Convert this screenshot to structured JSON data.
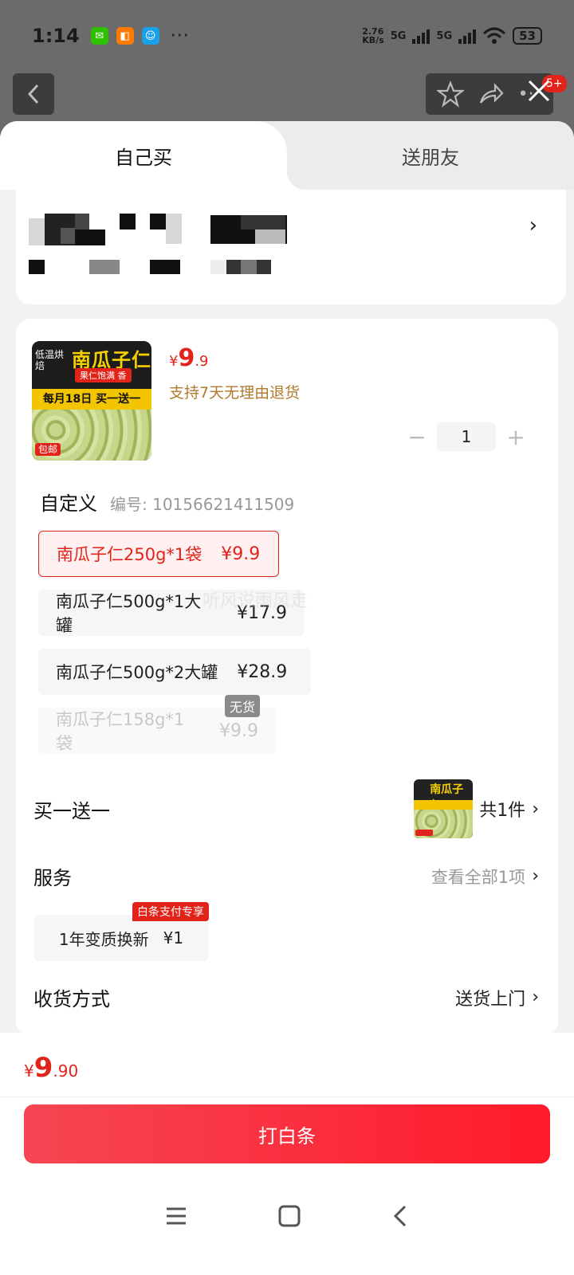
{
  "status": {
    "time": "1:14",
    "speed": "2.76\nKB/s",
    "net1": "5G",
    "net2": "5G",
    "battery": "53",
    "dots": "···"
  },
  "tabs": {
    "active": "自己买",
    "other": "送朋友"
  },
  "badge": "5+",
  "product": {
    "price": {
      "currency": "¥",
      "int": "9",
      "dec": ".9"
    },
    "return_policy": "支持7天无理由退货",
    "thumb": {
      "title": "南瓜子仁",
      "side": "低温烘焙",
      "sub": "果仁饱满 香",
      "yellow": "每月18日 买一送一",
      "ship": "包邮"
    },
    "quantity": "1",
    "spec_title": "自定义",
    "spec_code": "编号: 10156621411509",
    "options": [
      {
        "name": "南瓜子仁250g*1袋",
        "price": "¥9.9",
        "state": "selected"
      },
      {
        "name": "南瓜子仁500g*1大罐",
        "price": "¥17.9",
        "state": "normal"
      },
      {
        "name": "南瓜子仁500g*2大罐",
        "price": "¥28.9",
        "state": "normal"
      },
      {
        "name": "南瓜子仁158g*1袋",
        "price": "¥9.9",
        "state": "disabled"
      }
    ],
    "out_of_stock": "无货"
  },
  "promo": {
    "label": "买一送一",
    "count": "共1件"
  },
  "service": {
    "label": "服务",
    "view_all": "查看全部1项",
    "chip_name": "1年变质换新",
    "chip_price": "¥1",
    "chip_tag": "白条支付专享"
  },
  "delivery": {
    "label": "收货方式",
    "value": "送货上门"
  },
  "total": {
    "currency": "¥",
    "int": "9",
    "dec": ".90"
  },
  "pay_button": "打白条",
  "watermark": "听风说雨风走",
  "colors": {
    "accent": "#e2231a",
    "gold": "#b07a2c"
  }
}
